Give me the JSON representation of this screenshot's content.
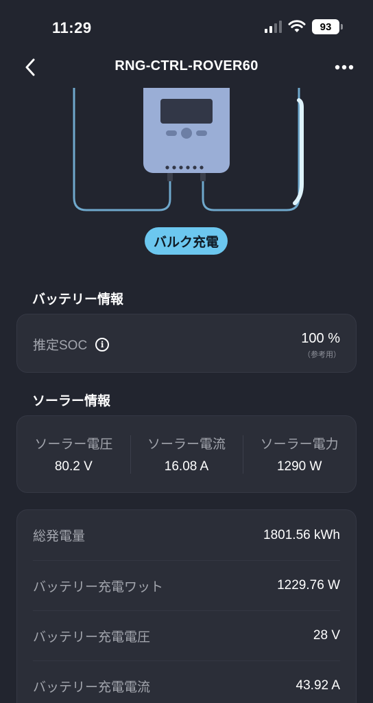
{
  "status_bar": {
    "time": "11:29",
    "battery": "93"
  },
  "nav": {
    "title": "RNG-CTRL-ROVER60"
  },
  "device": {
    "mode_badge": "バルク充電"
  },
  "battery_section": {
    "title": "バッテリー情報",
    "soc_label": "推定SOC",
    "soc_value": "100 %",
    "soc_note": "（参考用）"
  },
  "solar_section": {
    "title": "ソーラー情報",
    "items": [
      {
        "label": "ソーラー電圧",
        "value": "80.2 V"
      },
      {
        "label": "ソーラー電流",
        "value": "16.08 A"
      },
      {
        "label": "ソーラー電力",
        "value": "1290 W"
      }
    ]
  },
  "stats": [
    {
      "label": "総発電量",
      "value": "1801.56 kWh"
    },
    {
      "label": "バッテリー充電ワット",
      "value": "1229.76 W"
    },
    {
      "label": "バッテリー充電電圧",
      "value": "28 V"
    },
    {
      "label": "バッテリー充電電流",
      "value": "43.92 A"
    }
  ],
  "colors": {
    "background": "#22252f",
    "card": "#2b2e38",
    "accent": "#6cc7ef",
    "device": "#9aaed6"
  },
  "icons": [
    "signal-icon",
    "wifi-icon",
    "back-chevron-icon",
    "more-dots-icon",
    "info-icon"
  ]
}
